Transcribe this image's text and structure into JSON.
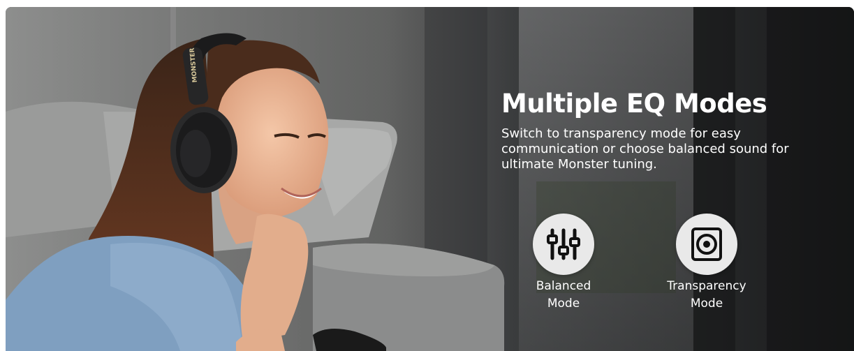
{
  "banner": {
    "headline": "Multiple EQ Modes",
    "description": "Switch to transparency mode for easy communication or choose balanced sound for ultimate Monster tuning.",
    "brand_text": "MONSTER"
  },
  "modes": [
    {
      "icon": "sliders-icon",
      "line1": "Balanced",
      "line2": "Mode"
    },
    {
      "icon": "speaker-icon",
      "line1": "Transparency",
      "line2": "Mode"
    }
  ],
  "colors": {
    "text": "#ffffff",
    "icon_circle": "#e9e9e9",
    "icon_glyph": "#111111",
    "sofa": "#8b8c8c",
    "shirt": "#7f9fc0",
    "headphones": "#1b1b1c"
  }
}
